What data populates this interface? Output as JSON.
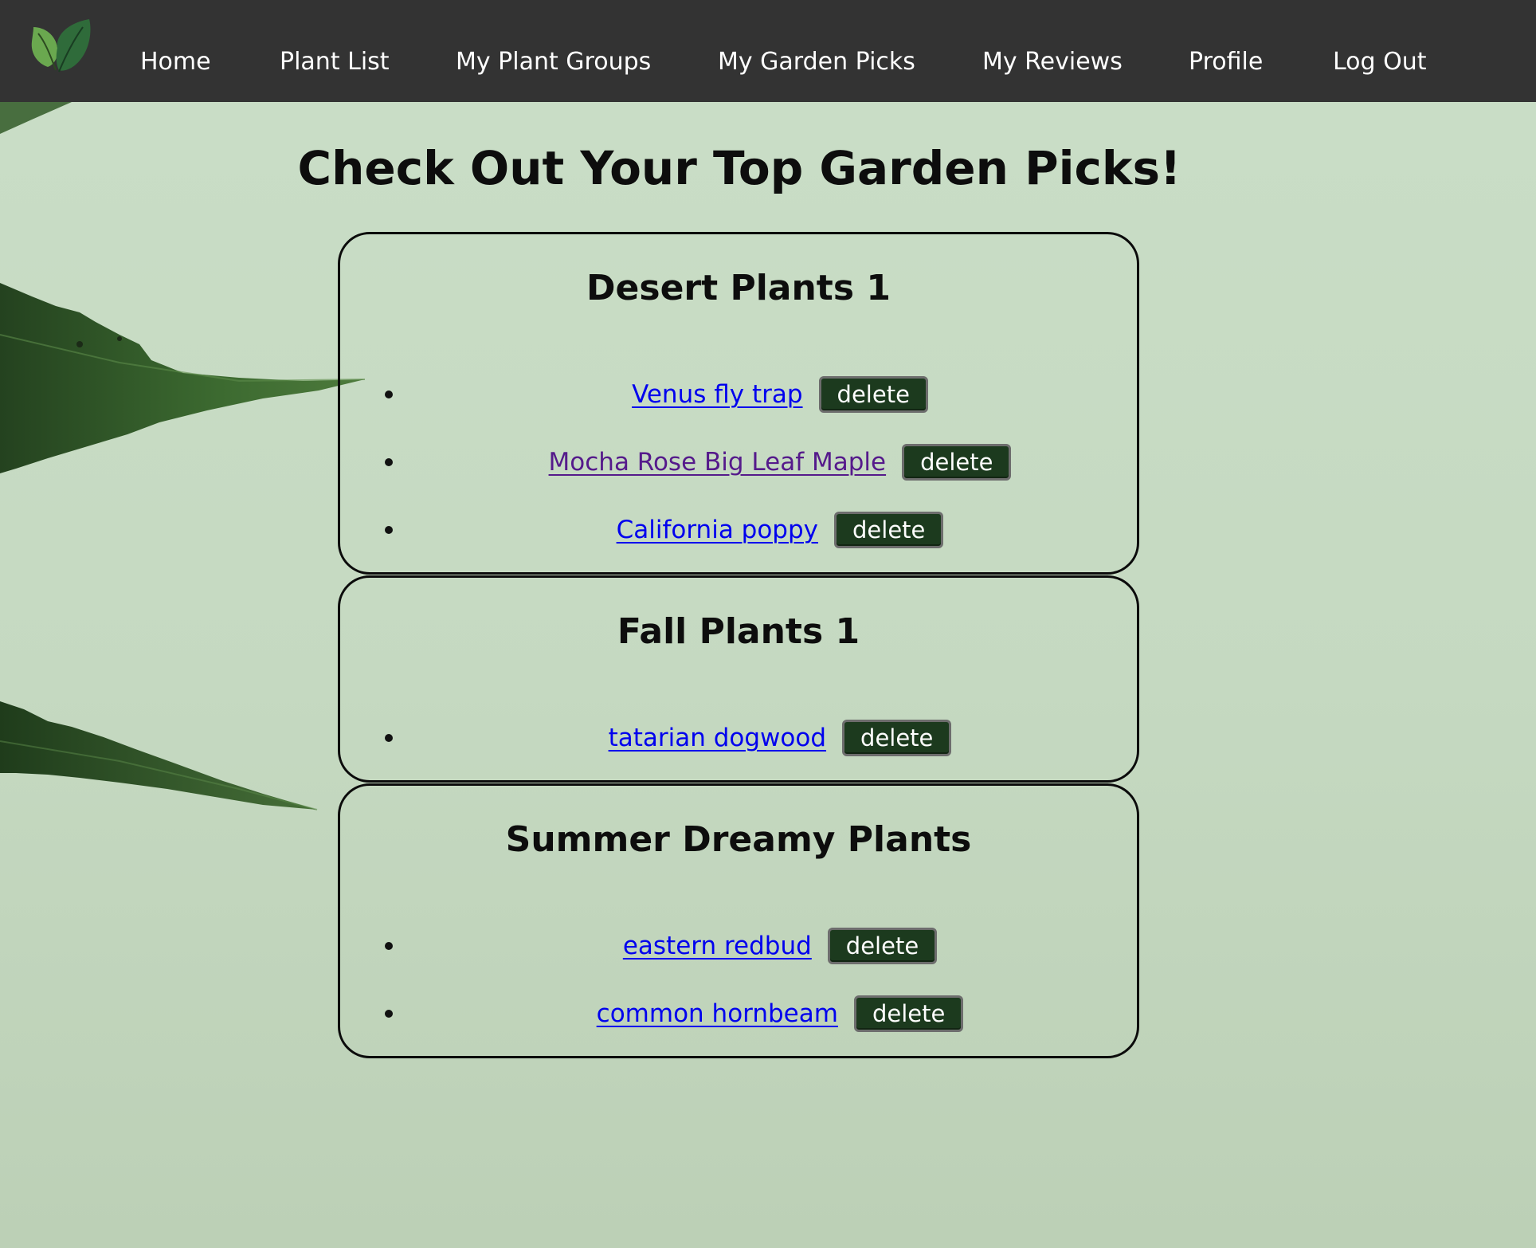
{
  "nav": {
    "links": [
      {
        "label": "Home"
      },
      {
        "label": "Plant List"
      },
      {
        "label": "My Plant Groups"
      },
      {
        "label": "My Garden Picks"
      },
      {
        "label": "My Reviews"
      },
      {
        "label": "Profile"
      },
      {
        "label": "Log Out"
      }
    ]
  },
  "page": {
    "title": "Check Out Your Top Garden Picks!"
  },
  "groups": [
    {
      "title": "Desert Plants 1",
      "plants": [
        {
          "name": "Venus fly trap",
          "visited": false,
          "action": "delete"
        },
        {
          "name": "Mocha Rose Big Leaf Maple",
          "visited": true,
          "action": "delete"
        },
        {
          "name": "California poppy",
          "visited": false,
          "action": "delete"
        }
      ]
    },
    {
      "title": "Fall Plants 1",
      "plants": [
        {
          "name": "tatarian dogwood",
          "visited": false,
          "action": "delete"
        }
      ]
    },
    {
      "title": "Summer Dreamy Plants",
      "plants": [
        {
          "name": "eastern redbud",
          "visited": false,
          "action": "delete"
        },
        {
          "name": "common hornbeam",
          "visited": false,
          "action": "delete"
        }
      ]
    }
  ],
  "colors": {
    "navbar": "#333333",
    "background": "#c8dcc5",
    "link": "#0000ee",
    "visited_link": "#551a8b",
    "button": "#1c3a1e"
  },
  "icons": {
    "logo": "leaf-logo-icon"
  }
}
